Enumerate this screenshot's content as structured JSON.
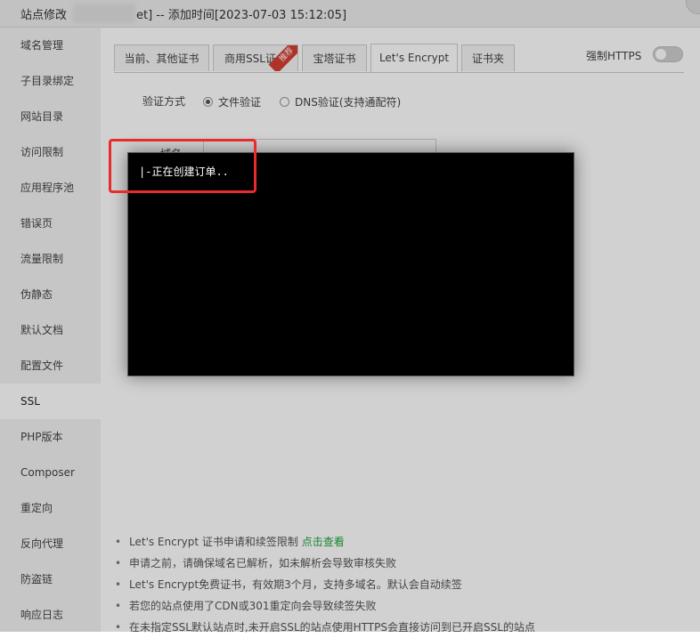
{
  "window": {
    "title_left": "站点修改",
    "title_main": "et] -- 添加时间[2023-07-03 15:12:05]"
  },
  "sidebar": {
    "items": [
      {
        "label": "域名管理"
      },
      {
        "label": "子目录绑定"
      },
      {
        "label": "网站目录"
      },
      {
        "label": "访问限制"
      },
      {
        "label": "应用程序池"
      },
      {
        "label": "错误页"
      },
      {
        "label": "流量限制"
      },
      {
        "label": "伪静态"
      },
      {
        "label": "默认文档"
      },
      {
        "label": "配置文件"
      },
      {
        "label": "SSL"
      },
      {
        "label": "PHP版本"
      },
      {
        "label": "Composer"
      },
      {
        "label": "重定向"
      },
      {
        "label": "反向代理"
      },
      {
        "label": "防盗链"
      },
      {
        "label": "响应日志"
      }
    ],
    "active_index": 10
  },
  "tabs": [
    {
      "label": "当前、其他证书"
    },
    {
      "label": "商用SSL证书",
      "badge": "推荐"
    },
    {
      "label": "宝塔证书"
    },
    {
      "label": "Let's Encrypt"
    },
    {
      "label": "证书夹"
    }
  ],
  "active_tab": 3,
  "force_https": {
    "label": "强制HTTPS",
    "enabled": false
  },
  "verify": {
    "label": "验证方式",
    "options": [
      {
        "label": "文件验证",
        "checked": true
      },
      {
        "label": "DNS验证(支持通配符)",
        "checked": false
      }
    ]
  },
  "domain": {
    "label": "域名",
    "value": ""
  },
  "notes": [
    {
      "text": "Let's Encrypt 证书申请和续签限制",
      "link": "点击查看"
    },
    {
      "text": "申请之前，请确保域名已解析，如未解析会导致审核失败"
    },
    {
      "text": "Let's Encrypt免费证书，有效期3个月，支持多域名。默认会自动续签"
    },
    {
      "text": "若您的站点使用了CDN或301重定向会导致续签失败"
    },
    {
      "text": "在未指定SSL默认站点时,未开启SSL的站点使用HTTPS会直接访问到已开启SSL的站点"
    }
  ],
  "terminal": {
    "log": "|-正在创建订单.."
  },
  "colors": {
    "highlight": "#e82b2b",
    "link": "#20a53a",
    "badge": "#d63f31",
    "terminal_bg": "#000000"
  }
}
